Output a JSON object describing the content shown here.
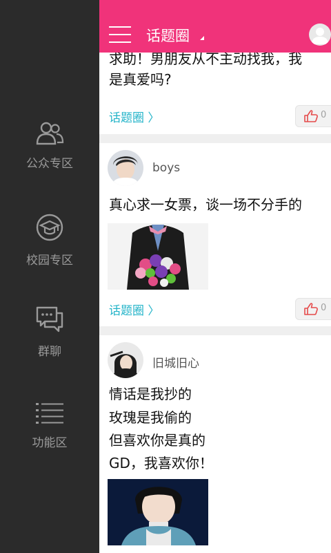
{
  "header": {
    "title": "话题圈"
  },
  "drawer": {
    "items": [
      {
        "label": "公众专区",
        "icon": "users-icon"
      },
      {
        "label": "校园专区",
        "icon": "graduation-cap-icon"
      },
      {
        "label": "群聊",
        "icon": "chat-bubbles-icon"
      },
      {
        "label": "功能区",
        "icon": "list-icon"
      }
    ]
  },
  "posts": [
    {
      "text_lines": [
        "求助！男朋友从不主动找我，我",
        "是真爱吗?"
      ],
      "topic": "话题圈 〉",
      "likes": "0"
    },
    {
      "username": "boys",
      "text_lines": [
        "真心求一女票，谈一场不分手的"
      ],
      "topic": "话题圈 〉",
      "likes": "0"
    },
    {
      "username": "旧城旧心",
      "text_lines": [
        "情话是我抄的",
        "玫瑰是我偷的",
        "但喜欢你是真的",
        "GD，我喜欢你！"
      ]
    }
  ],
  "colors": {
    "accent": "#f0337a",
    "link": "#24b4c9",
    "drawer_bg": "#2b2b2b"
  }
}
